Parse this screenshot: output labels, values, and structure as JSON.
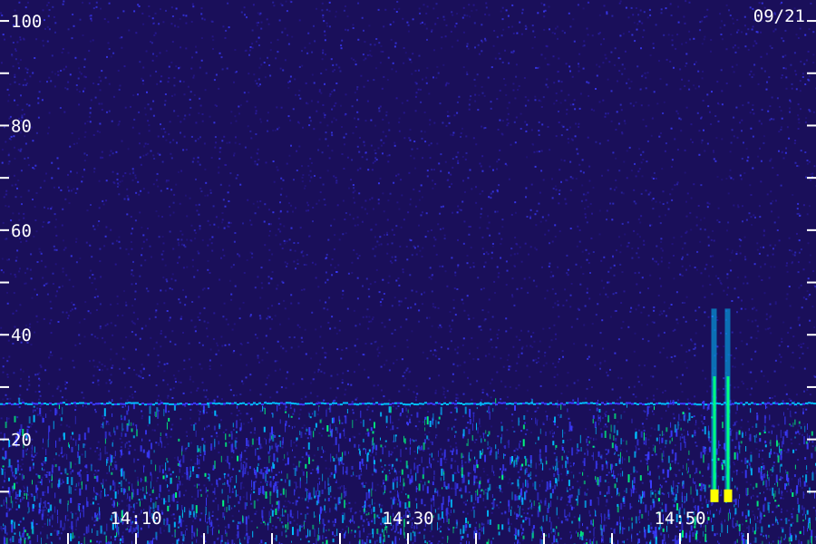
{
  "chart_data": {
    "type": "heatmap",
    "title": "",
    "date_label": "09/21",
    "xlabel": "",
    "ylabel": "",
    "y_ticks": [
      {
        "value": 100,
        "label": "100"
      },
      {
        "value": 80,
        "label": "80"
      },
      {
        "value": 60,
        "label": "60"
      },
      {
        "value": 40,
        "label": "40"
      },
      {
        "value": 20,
        "label": "20"
      }
    ],
    "y_minor_ticks": [
      90,
      70,
      50,
      30,
      10
    ],
    "ylim": [
      0,
      104
    ],
    "x_ticks": [
      {
        "value": "14:10",
        "label": "14:10"
      },
      {
        "value": "14:30",
        "label": "14:30"
      },
      {
        "value": "14:50",
        "label": "14:50"
      }
    ],
    "x_range": [
      "14:00",
      "15:00"
    ],
    "x_minor_ticks": [
      "14:05",
      "14:15",
      "14:20",
      "14:25",
      "14:35",
      "14:40",
      "14:45",
      "14:55"
    ],
    "colormap": [
      "#1a0f5a",
      "#2a1aa0",
      "#3b3bff",
      "#00bfff",
      "#00ff80",
      "#ffff00",
      "#ff8000"
    ],
    "background_color": "#1a0f5a",
    "features": [
      {
        "name": "noise floor band",
        "time_start": "14:00",
        "time_end": "15:00",
        "freq_low": 0,
        "freq_high": 28,
        "intensity": "medium"
      },
      {
        "name": "constant line",
        "time_start": "14:00",
        "time_end": "15:00",
        "freq": 27,
        "intensity": "medium"
      },
      {
        "name": "event",
        "time": "14:52.5",
        "freq_low": 8,
        "freq_high": 45,
        "intensity": "high"
      },
      {
        "name": "event",
        "time": "14:53.5",
        "freq_low": 8,
        "freq_high": 45,
        "intensity": "high"
      }
    ]
  }
}
